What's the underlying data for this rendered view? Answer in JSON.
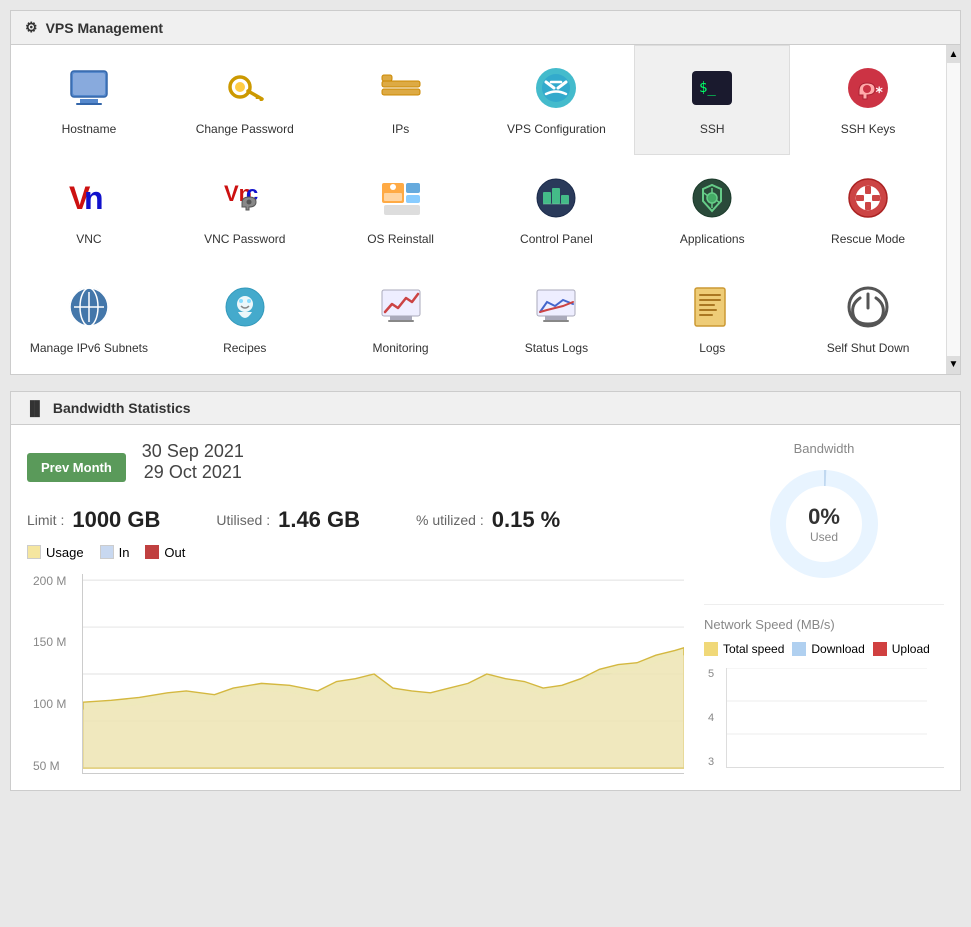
{
  "vps_panel": {
    "title": "VPS Management",
    "items": [
      {
        "id": "hostname",
        "label": "Hostname",
        "icon": "monitor"
      },
      {
        "id": "change-password",
        "label": "Change Password",
        "icon": "key"
      },
      {
        "id": "ips",
        "label": "IPs",
        "icon": "network"
      },
      {
        "id": "vps-configuration",
        "label": "VPS Configuration",
        "icon": "settings-scissors"
      },
      {
        "id": "ssh",
        "label": "SSH",
        "icon": "terminal",
        "active": true
      },
      {
        "id": "ssh-keys",
        "label": "SSH Keys",
        "icon": "key-red"
      },
      {
        "id": "vnc",
        "label": "VNC",
        "icon": "vnc"
      },
      {
        "id": "vnc-password",
        "label": "VNC Password",
        "icon": "vnc-password"
      },
      {
        "id": "os-reinstall",
        "label": "OS Reinstall",
        "icon": "os-reinstall"
      },
      {
        "id": "control-panel",
        "label": "Control Panel",
        "icon": "control-panel"
      },
      {
        "id": "applications",
        "label": "Applications",
        "icon": "applications"
      },
      {
        "id": "rescue-mode",
        "label": "Rescue Mode",
        "icon": "rescue"
      },
      {
        "id": "manage-ipv6",
        "label": "Manage IPv6 Subnets",
        "icon": "ipv6"
      },
      {
        "id": "recipes",
        "label": "Recipes",
        "icon": "recipes"
      },
      {
        "id": "monitoring",
        "label": "Monitoring",
        "icon": "monitoring"
      },
      {
        "id": "status-logs",
        "label": "Status Logs",
        "icon": "status-logs"
      },
      {
        "id": "logs",
        "label": "Logs",
        "icon": "logs"
      },
      {
        "id": "self-shut-down",
        "label": "Self Shut Down",
        "icon": "shut-down"
      }
    ]
  },
  "bandwidth_panel": {
    "title": "Bandwidth Statistics",
    "prev_month_label": "Prev Month",
    "date_start": "30 Sep 2021",
    "date_end": "29 Oct 2021",
    "limit_label": "Limit :",
    "limit_value": "1000 GB",
    "utilised_label": "Utilised :",
    "utilised_value": "1.46 GB",
    "utilized_pct_label": "% utilized :",
    "utilized_pct_value": "0.15 %",
    "legend": [
      {
        "label": "Usage",
        "color": "#f5e6a0"
      },
      {
        "label": "In",
        "color": "#c8d8f0"
      },
      {
        "label": "Out",
        "color": "#c04040"
      }
    ],
    "y_labels": [
      "200 M",
      "150 M",
      "100 M",
      "50 M"
    ],
    "donut": {
      "title": "Bandwidth",
      "percent": "0%",
      "used_label": "Used",
      "color_used": "#c0d8f0",
      "color_remaining": "#e8f4ff"
    },
    "network_speed": {
      "title": "Network Speed (MB/s)",
      "legend": [
        {
          "label": "Total speed",
          "color": "#f0d878"
        },
        {
          "label": "Download",
          "color": "#b0d0f0"
        },
        {
          "label": "Upload",
          "color": "#d04040"
        }
      ],
      "y_labels": [
        "5",
        "4",
        "3"
      ]
    }
  }
}
